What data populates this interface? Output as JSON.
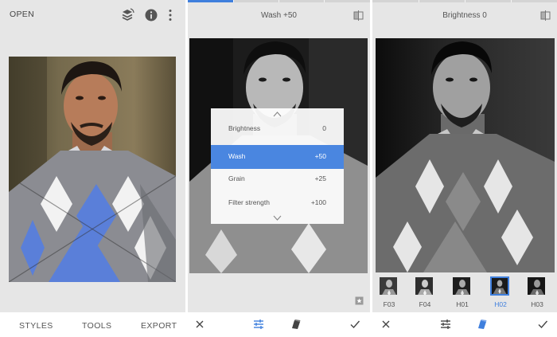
{
  "panel1": {
    "open_label": "OPEN",
    "icons": [
      "layers-icon",
      "info-icon",
      "more-vertical-icon"
    ],
    "bottom_tabs": [
      "STYLES",
      "TOOLS",
      "EXPORT"
    ]
  },
  "panel2": {
    "title": "Wash +50",
    "progress_fraction": 0.25,
    "adjustments": [
      {
        "label": "Brightness",
        "value": "0",
        "active": false
      },
      {
        "label": "Wash",
        "value": "+50",
        "active": true
      },
      {
        "label": "Grain",
        "value": "+25",
        "active": false
      },
      {
        "label": "Filter strength",
        "value": "+100",
        "active": false
      }
    ],
    "icons": [
      "compare-icon",
      "chevron-up-icon",
      "chevron-down-icon",
      "bookmark-icon",
      "close-icon",
      "adjust-sliders-icon",
      "styles-icon",
      "check-icon"
    ]
  },
  "panel3": {
    "title": "Brightness 0",
    "filters": [
      {
        "label": "F03",
        "selected": false
      },
      {
        "label": "F04",
        "selected": false
      },
      {
        "label": "H01",
        "selected": false
      },
      {
        "label": "H02",
        "selected": true
      },
      {
        "label": "H03",
        "selected": false
      }
    ],
    "icons": [
      "compare-icon",
      "close-icon",
      "adjust-sliders-icon",
      "styles-icon",
      "check-icon"
    ]
  },
  "colors": {
    "accent": "#3f7fdd",
    "panel_bg": "#e6e6e6",
    "sweater_blue": "#5a7fd9"
  }
}
